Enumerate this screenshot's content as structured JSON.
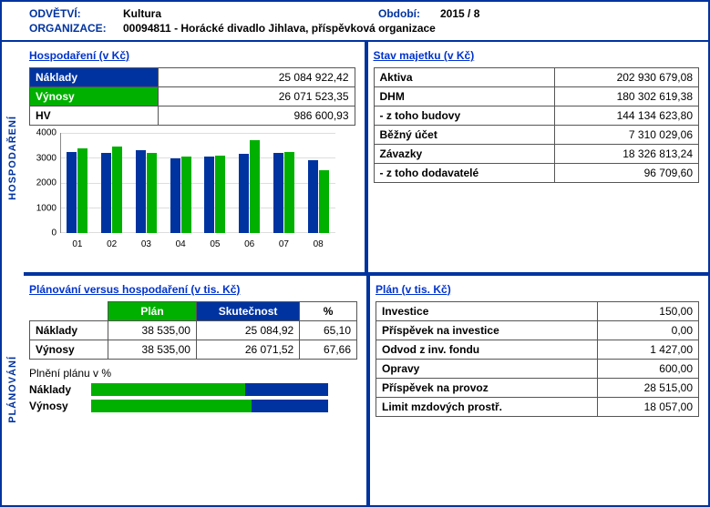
{
  "header": {
    "odvetvi_label": "ODVĚTVÍ:",
    "odvetvi": "Kultura",
    "obdobi_label": "Období:",
    "obdobi": "2015 / 8",
    "org_label": "ORGANIZACE:",
    "org": "00094811 - Horácké divadlo Jihlava, příspěvková organizace"
  },
  "tabs": {
    "top": "HOSPODAŘENÍ",
    "bottom": "PLÁNOVÁNÍ"
  },
  "hosp": {
    "title": "Hospodaření (v Kč)",
    "rows": {
      "naklady_l": "Náklady",
      "naklady_v": "25 084 922,42",
      "vynosy_l": "Výnosy",
      "vynosy_v": "26 071 523,35",
      "hv_l": "HV",
      "hv_v": "986 600,93"
    }
  },
  "majetek": {
    "title": "Stav majetku (v Kč)",
    "rows": [
      {
        "l": "Aktiva",
        "v": "202 930 679,08"
      },
      {
        "l": "DHM",
        "v": "180 302 619,38"
      },
      {
        "l": "- z toho budovy",
        "v": "144 134 623,80"
      },
      {
        "l": "Běžný účet",
        "v": "7 310 029,06"
      },
      {
        "l": "Závazky",
        "v": "18 326 813,24"
      },
      {
        "l": "- z toho dodavatelé",
        "v": "96 709,60"
      }
    ]
  },
  "planhosp": {
    "title": "Plánování versus hospodaření (v tis. Kč)",
    "head": {
      "plan": "Plán",
      "skut": "Skutečnost",
      "pct": "%"
    },
    "rows": [
      {
        "l": "Náklady",
        "plan": "38 535,00",
        "skut": "25 084,92",
        "pct": "65,10"
      },
      {
        "l": "Výnosy",
        "plan": "38 535,00",
        "skut": "26 071,52",
        "pct": "67,66"
      }
    ],
    "pb_title": "Plnění plánu v %",
    "pb": [
      {
        "l": "Náklady",
        "pct": 65.1
      },
      {
        "l": "Výnosy",
        "pct": 67.66
      }
    ]
  },
  "plan": {
    "title": "Plán (v tis. Kč)",
    "rows": [
      {
        "l": "Investice",
        "v": "150,00"
      },
      {
        "l": "Příspěvek na investice",
        "v": "0,00"
      },
      {
        "l": "Odvod z inv. fondu",
        "v": "1 427,00"
      },
      {
        "l": "Opravy",
        "v": "600,00"
      },
      {
        "l": "Příspěvek na provoz",
        "v": "28 515,00"
      },
      {
        "l": "Limit mzdových prostř.",
        "v": "18 057,00"
      }
    ]
  },
  "chart_data": {
    "type": "bar",
    "title": "",
    "xlabel": "",
    "ylabel": "",
    "ylim": [
      0,
      4000
    ],
    "yticks": [
      0,
      1000,
      2000,
      3000,
      4000
    ],
    "categories": [
      "01",
      "02",
      "03",
      "04",
      "05",
      "06",
      "07",
      "08"
    ],
    "series": [
      {
        "name": "Náklady",
        "color": "#0033a0",
        "values": [
          3250,
          3200,
          3300,
          3000,
          3050,
          3150,
          3200,
          2900
        ]
      },
      {
        "name": "Výnosy",
        "color": "#00b000",
        "values": [
          3400,
          3450,
          3200,
          3050,
          3100,
          3700,
          3250,
          2500
        ]
      }
    ]
  }
}
